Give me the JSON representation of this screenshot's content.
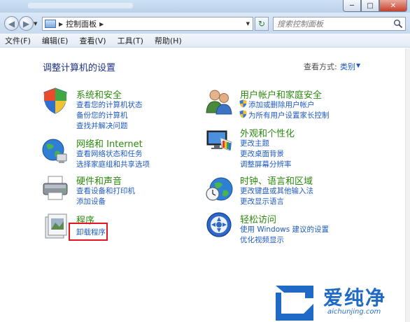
{
  "window": {
    "minimize": "─",
    "maximize": "□",
    "close": "✕"
  },
  "address": {
    "path": "控制面板",
    "separator": "▶",
    "refresh": "↻",
    "dropdown": "▼"
  },
  "search": {
    "placeholder": "搜索控制面板"
  },
  "menu": [
    "文件(F)",
    "编辑(E)",
    "查看(V)",
    "工具(T)",
    "帮助(H)"
  ],
  "main": {
    "title": "调整计算机的设置",
    "view_label": "查看方式:",
    "view_value": "类别",
    "view_caret": "▼"
  },
  "categories": {
    "system": {
      "title": "系统和安全",
      "icon": "system-security-shield-icon",
      "links": [
        "查看您的计算机状态",
        "备份您的计算机",
        "查找并解决问题"
      ]
    },
    "network": {
      "title": "网络和 Internet",
      "icon": "network-globe-icon",
      "links": [
        "查看网络状态和任务",
        "选择家庭组和共享选项"
      ]
    },
    "hardware": {
      "title": "硬件和声音",
      "icon": "printer-icon",
      "links": [
        "查看设备和打印机",
        "添加设备"
      ]
    },
    "programs": {
      "title": "程序",
      "icon": "programs-icon",
      "links": [
        "卸载程序"
      ]
    },
    "users": {
      "title": "用户帐户和家庭安全",
      "icon": "users-icon",
      "links": [
        "添加或删除用户帐户",
        "为所有用户设置家长控制"
      ]
    },
    "appearance": {
      "title": "外观和个性化",
      "icon": "monitor-palette-icon",
      "links": [
        "更改主题",
        "更改桌面背景",
        "调整屏幕分辨率"
      ]
    },
    "clock": {
      "title": "时钟、语言和区域",
      "icon": "clock-globe-icon",
      "links": [
        "更改键盘或其他输入法",
        "更改显示语言"
      ]
    },
    "ease": {
      "title": "轻松访问",
      "icon": "ease-of-access-icon",
      "links": [
        "使用 Windows 建议的设置",
        "优化视频显示"
      ]
    }
  },
  "watermark": {
    "brand": "爱纯净",
    "url": "aichunjing.com"
  },
  "colors": {
    "category_title": "#2c8a0f",
    "link": "#1f5bc2",
    "page_title": "#1e3287",
    "highlight": "#e5151f"
  }
}
